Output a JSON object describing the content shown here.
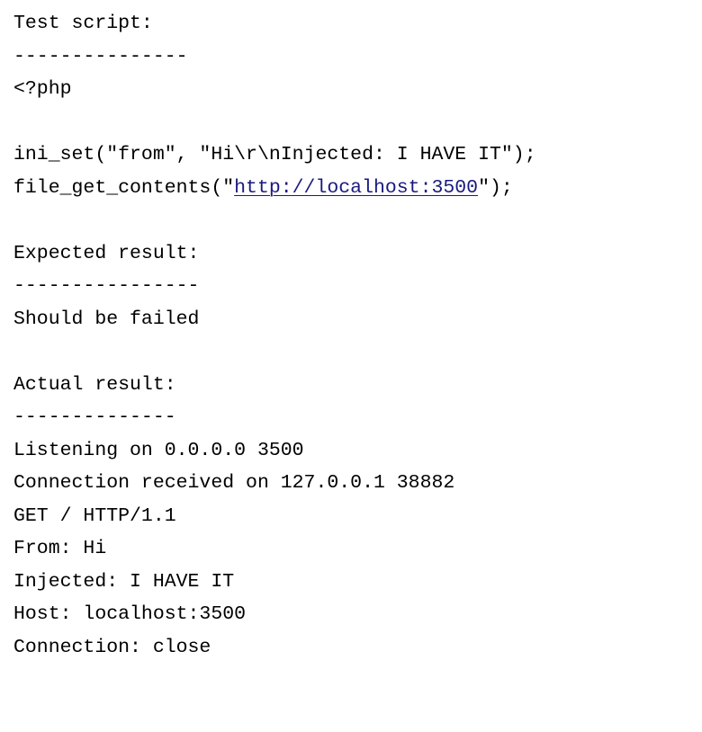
{
  "test_script": {
    "heading": "Test script:",
    "rule": "---------------",
    "code_open": "<?php",
    "ini_set_line": "ini_set(\"from\", \"Hi\\r\\nInjected: I HAVE IT\");",
    "fgc_prefix": "file_get_contents(\"",
    "fgc_url": "http://localhost:3500",
    "fgc_suffix": "\");"
  },
  "expected": {
    "heading": "Expected result:",
    "rule": "----------------",
    "text": "Should be failed"
  },
  "actual": {
    "heading": "Actual result:",
    "rule": "--------------",
    "lines": [
      "Listening on 0.0.0.0 3500",
      "Connection received on 127.0.0.1 38882",
      "GET / HTTP/1.1",
      "From: Hi",
      "Injected: I HAVE IT",
      "Host: localhost:3500",
      "Connection: close"
    ]
  },
  "colors": {
    "text": "#000000",
    "link": "#1a1a80",
    "background": "#ffffff"
  }
}
